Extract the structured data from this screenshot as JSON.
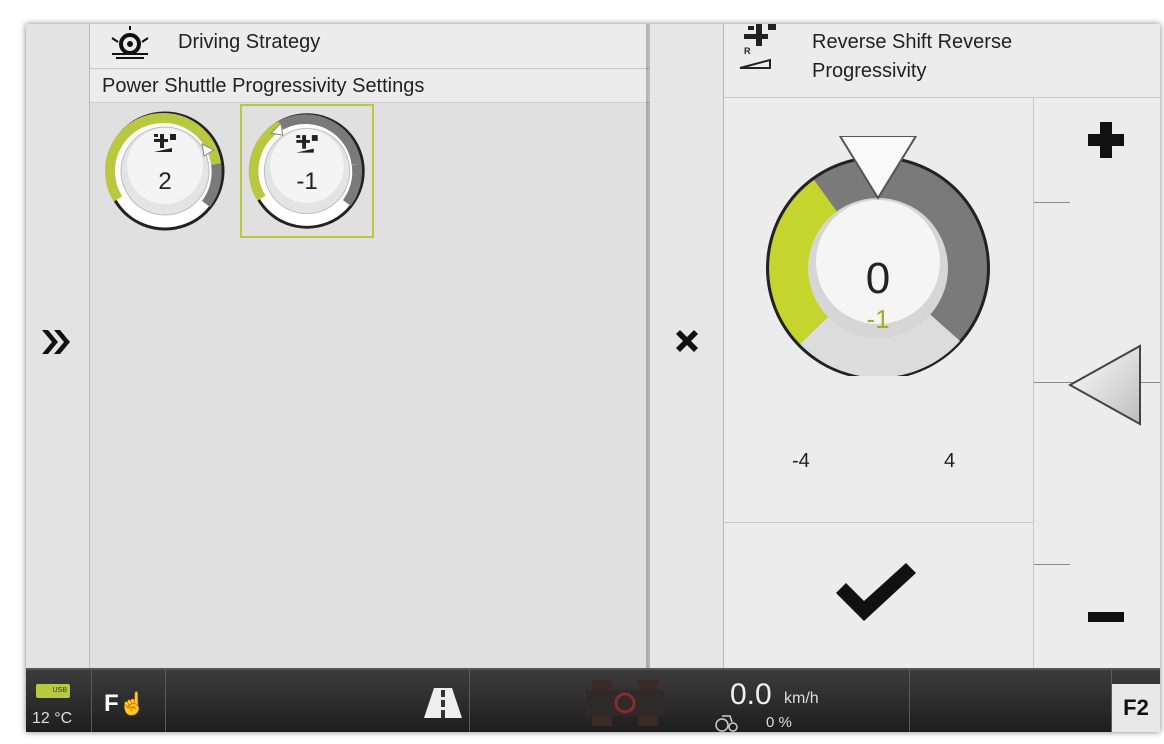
{
  "left_panel": {
    "breadcrumb": "Driving Strategy",
    "section_title": "Power Shuttle Progressivity Settings",
    "dials": [
      {
        "value": "2",
        "level": 2
      },
      {
        "value": "-1",
        "level": -1,
        "selected": true
      }
    ]
  },
  "right_panel": {
    "title": "Reverse Shift Reverse Progressivity",
    "dial": {
      "current": "0",
      "new": "-1",
      "min": "-4",
      "max": "4"
    }
  },
  "status_bar": {
    "temperature": "12 °C",
    "usb_label": "USB",
    "speed_value": "0.0",
    "speed_unit": "km/h",
    "slip": "0 %",
    "f2_label": "F2"
  },
  "colors": {
    "accent": "#b9c840",
    "dark_gray": "#7a7a7a",
    "background": "#ececec"
  },
  "icons": [
    "double-chevron-right-icon",
    "driving-strategy-icon",
    "shuttle-progressivity-icon",
    "close-icon",
    "check-icon",
    "plus-icon",
    "minus-icon",
    "f-hand-icon",
    "road-icon",
    "tractor-icon",
    "slip-icon"
  ]
}
